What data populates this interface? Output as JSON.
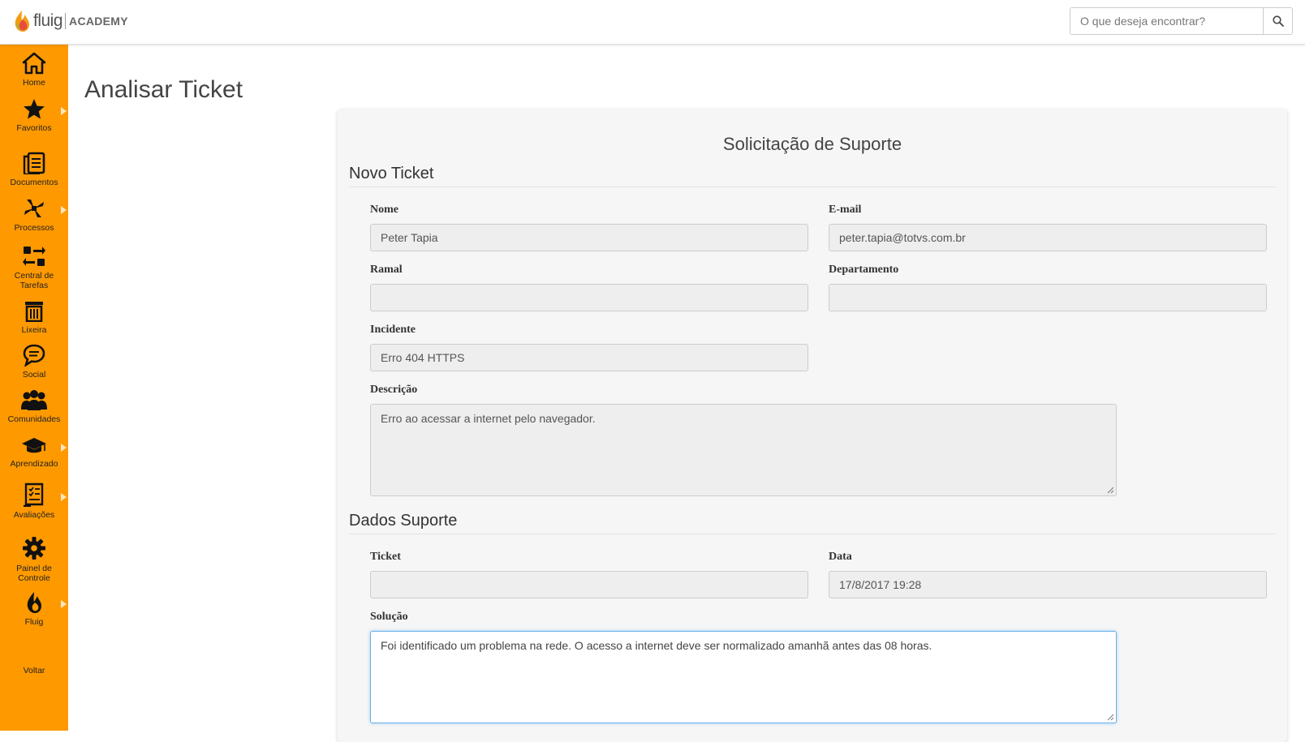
{
  "header": {
    "logo_text": "fluig",
    "logo_suffix": "ACADEMY",
    "search_placeholder": "O que deseja encontrar?"
  },
  "sidebar": {
    "items": [
      {
        "label": "Home",
        "icon": "home-icon"
      },
      {
        "label": "Favoritos",
        "icon": "star-icon"
      },
      {
        "label": "Documentos",
        "icon": "documents-icon"
      },
      {
        "label": "Processos",
        "icon": "processes-icon"
      },
      {
        "label": "Central de Tarefas",
        "icon": "tasks-icon"
      },
      {
        "label": "Lixeira",
        "icon": "trash-icon"
      },
      {
        "label": "Social",
        "icon": "chat-icon"
      },
      {
        "label": "Comunidades",
        "icon": "communities-icon"
      },
      {
        "label": "Aprendizado",
        "icon": "graduation-cap-icon"
      },
      {
        "label": "Avaliações",
        "icon": "evaluation-icon"
      },
      {
        "label": "Painel de Controle",
        "icon": "gear-icon"
      },
      {
        "label": "Fluig",
        "icon": "fluig-flame-icon"
      },
      {
        "label": "Voltar",
        "icon": ""
      }
    ]
  },
  "page": {
    "title": "Analisar Ticket"
  },
  "form": {
    "title": "Solicitação de Suporte",
    "section_new": "Novo Ticket",
    "section_support": "Dados Suporte",
    "nome": {
      "label": "Nome",
      "value": "Peter Tapia"
    },
    "email": {
      "label": "E-mail",
      "value": "peter.tapia@totvs.com.br"
    },
    "ramal": {
      "label": "Ramal",
      "value": ""
    },
    "departamento": {
      "label": "Departamento",
      "value": ""
    },
    "incidente": {
      "label": "Incidente",
      "value": "Erro 404 HTTPS"
    },
    "descricao": {
      "label": "Descrição",
      "value": "Erro ao acessar a internet pelo navegador."
    },
    "ticket": {
      "label": "Ticket",
      "value": ""
    },
    "data": {
      "label": "Data",
      "value": "17/8/2017 19:28"
    },
    "solucao": {
      "label": "Solução",
      "value": "Foi identificado um problema na rede. O acesso a internet deve ser normalizado amanhã antes das 08 horas."
    }
  },
  "colors": {
    "sidebar": "#ff9900",
    "focus_border": "#66afe9"
  }
}
